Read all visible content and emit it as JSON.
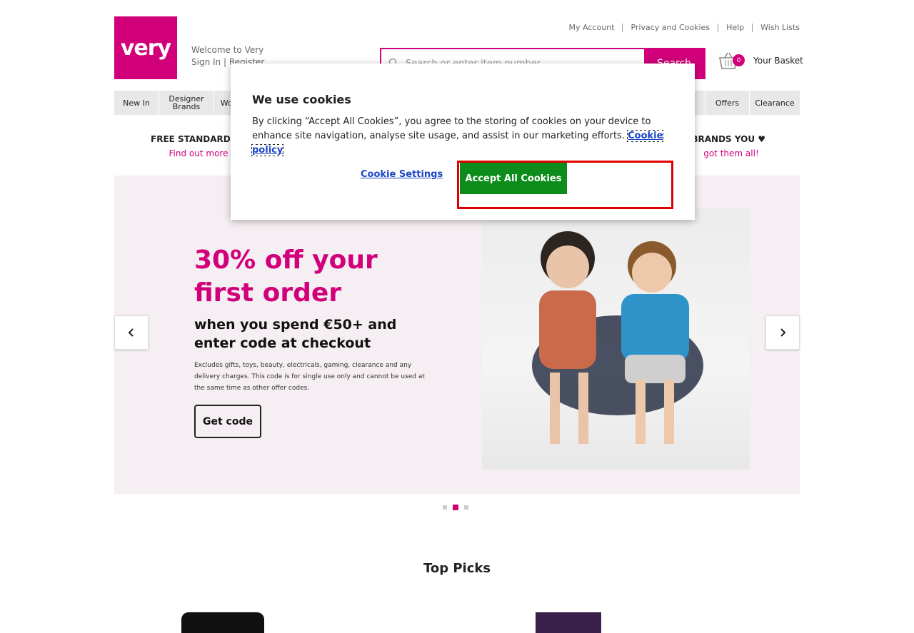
{
  "header": {
    "logo_text": "very",
    "welcome": "Welcome to Very",
    "sign_in": "Sign In",
    "separator": "|",
    "register": "Register",
    "top_links": [
      "My Account",
      "Privacy and Cookies",
      "Help",
      "Wish Lists"
    ],
    "search_placeholder": "Search or enter item number",
    "search_button": "Search",
    "basket_count": "0",
    "basket_label": "Your Basket"
  },
  "nav": {
    "items": [
      "New In",
      "Designer Brands",
      "Women",
      "",
      "",
      "",
      "",
      "",
      "",
      "",
      "",
      "",
      "Offers",
      "Clearance"
    ]
  },
  "promos": [
    {
      "title": "FREE STANDARD DE",
      "link": "Find out more"
    },
    {
      "title": "E BRANDS YOU ♥",
      "link": "got them all!"
    }
  ],
  "hero": {
    "headline": "30% off your first order",
    "subhead": "when you spend €50+ and enter code at checkout",
    "small_print": "Excludes gifts, toys, beauty, electricals, gaming, clearance and any delivery charges. This code is for single use only and cannot be used at the same time as other offer codes.",
    "cta": "Get code"
  },
  "carousel": {
    "slides": 3,
    "active": 2
  },
  "section_title": "Top Picks",
  "cookie_modal": {
    "title": "We use cookies",
    "body": "By clicking “Accept All Cookies”, you agree to the storing of cookies on your device to enhance site navigation, analyse site usage, and assist in our marketing efforts.",
    "policy_link": "Cookie policy",
    "settings_button": "Cookie Settings",
    "accept_button": "Accept All Cookies"
  },
  "colors": {
    "brand": "#d1007a",
    "accept": "#0c8c1a",
    "link": "#1a46c8",
    "highlight": "#e00000"
  }
}
